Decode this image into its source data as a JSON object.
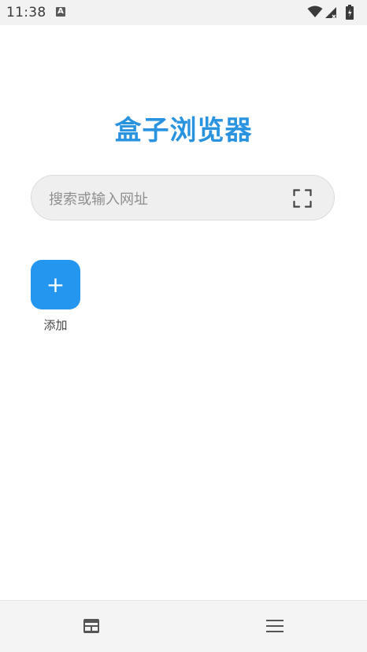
{
  "status_bar": {
    "time": "11:38",
    "notification_badge": "A",
    "icons": [
      "wifi-icon",
      "signal-icon",
      "battery-icon"
    ]
  },
  "app": {
    "title": "盒子浏览器",
    "title_color": "#2a93e0"
  },
  "search": {
    "placeholder": "搜索或输入网址",
    "value": "",
    "scan_icon": "scan-icon"
  },
  "shortcuts": {
    "add_symbol": "+",
    "add_label": "添加",
    "add_color": "#2596f0"
  },
  "bottom_bar": {
    "icons": [
      "tabs-icon",
      "menu-icon"
    ]
  }
}
